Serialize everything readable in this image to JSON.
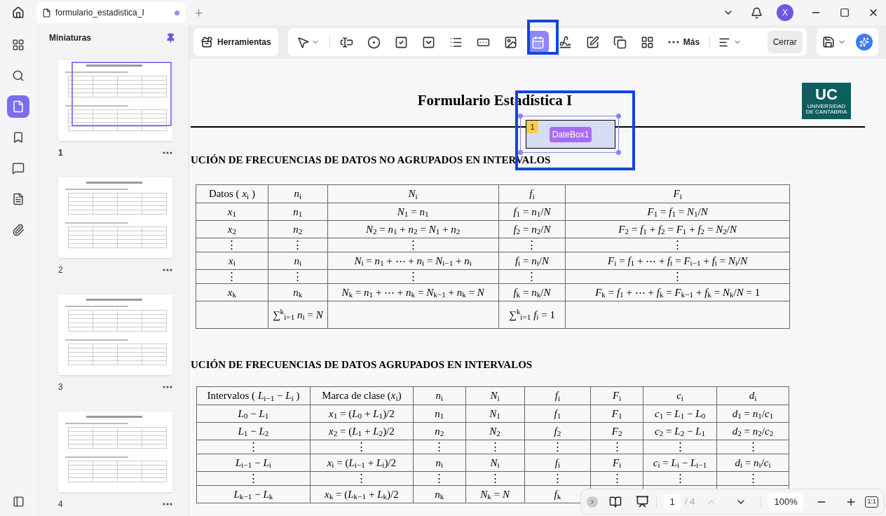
{
  "title_bar": {
    "tab": {
      "title": "formulario_estadistica_I",
      "modified": true
    },
    "avatar": "X"
  },
  "rail": [
    {
      "selected": false
    },
    {
      "selected": false
    },
    {
      "selected": true
    },
    {
      "selected": false
    },
    {
      "selected": false
    },
    {
      "selected": false
    },
    {
      "selected": false
    }
  ],
  "thumbnails": {
    "title": "Miniaturas",
    "pages": [
      {
        "label": "1",
        "selected": true
      },
      {
        "label": "2",
        "selected": false
      },
      {
        "label": "3",
        "selected": false
      },
      {
        "label": "4",
        "selected": false
      }
    ]
  },
  "toolbar": {
    "tools_button": "Herramientas",
    "tools": [
      {
        "selected": false
      },
      {
        "selected": false
      },
      {
        "selected": false
      },
      {
        "selected": false
      },
      {
        "selected": false
      },
      {
        "selected": false
      },
      {
        "selected": false
      },
      {
        "selected": false
      },
      {
        "selected": true
      },
      {
        "selected": false
      },
      {
        "selected": false
      },
      {
        "selected": false
      },
      {
        "selected": false
      }
    ],
    "more": "Más",
    "close": "Cerrar"
  },
  "document": {
    "title": "Formulario Estadística I",
    "logo": {
      "mark": "UC",
      "line1": "UNIVERSIDAD",
      "line2": "DE CANTABRIA"
    },
    "date_field": {
      "number": "1",
      "label": "DateBox1"
    },
    "sections": [
      {
        "heading": "UCIÓN DE FRECUENCIAS DE DATOS NO AGRUPADOS EN INTERVALOS",
        "table": {
          "header": [
            "Datos ( *x*$_{i}$ )",
            "*n*$_{i}$",
            "*N*$_{i}$",
            "*f*$_{i}$",
            "*F*$_{i}$"
          ],
          "rows": [
            {
              "kind": "math",
              "cells": [
                "*x*$_{1}$",
                "*n*$_{1}$",
                "*N*$_{1}$ = *n*$_{1}$",
                "*f*$_{1}$ = *n*$_{1}$/*N*",
                "*F*$_{1}$ = *f*$_{1}$ = *N*$_{1}$/*N*"
              ]
            },
            {
              "kind": "math",
              "cells": [
                "*x*$_{2}$",
                "*n*$_{2}$",
                "*N*$_{2}$ = *n*$_{1}$ + *n*$_{2}$ = *N*$_{1}$ + *n*$_{2}$",
                "*f*$_{2}$ = *n*$_{2}$/*N*",
                "*F*$_{2}$ = *f*$_{1}$ + *f*$_{2}$ = *F*$_{1}$ + *f*$_{2}$ = *N*$_{2}$/*N*"
              ]
            },
            {
              "kind": "dots",
              "cells": [
                "⋮",
                "⋮",
                "⋮",
                "⋮",
                "⋮"
              ]
            },
            {
              "kind": "math",
              "cells": [
                "*x*$_{i}$",
                "*n*$_{i}$",
                "*N*$_{i}$ = *n*$_{1}$ + ⋯ + *n*$_{i}$ = *N*$_{i−1}$ + *n*$_{i}$",
                "*f*$_{i}$ = *n*$_{i}$/*N*",
                "*F*$_{i}$ = *f*$_{1}$ + ⋯ + *f*$_{i}$ = *F*$_{i−1}$ + *f*$_{i}$ = *N*$_{i}$/*N*"
              ]
            },
            {
              "kind": "dots",
              "cells": [
                "⋮",
                "⋮",
                "⋮",
                "⋮",
                "⋮"
              ]
            },
            {
              "kind": "math",
              "cells": [
                "*x*$_{k}$",
                "*n*$_{k}$",
                "*N*$_{k}$ = *n*$_{1}$ + ⋯ + *n*$_{k}$ = *N*$_{k−1}$ + *n*$_{k}$ = *N*",
                "*f*$_{k}$ = *n*$_{k}$/*N*",
                "*F*$_{k}$ = *f*$_{1}$ + ⋯ + *f*$_{k}$ = *F*$_{k−1}$ + *f*$_{k}$ = *N*$_{k}$/*N* = 1"
              ]
            },
            {
              "kind": "sum",
              "cells": [
                null,
                "∑$^{k}$$_{i=1}$ *n*$_{i}$ = *N*",
                null,
                "∑$^{k}$$_{i=1}$ *f*$_{i}$ = 1",
                null
              ]
            }
          ]
        }
      },
      {
        "heading": "UCIÓN DE FRECUENCIAS DE DATOS AGRUPADOS EN INTERVALOS",
        "table": {
          "header": [
            "Intervalos ( *L*$_{i−1}$ − *L*$_{i}$ )",
            "Marca de clase (*x*$_{i}$)",
            "*n*$_{i}$",
            "*N*$_{i}$",
            "*f*$_{i}$",
            "*F*$_{i}$",
            "*c*$_{i}$",
            "*d*$_{i}$"
          ],
          "rows": [
            {
              "kind": "math",
              "cells": [
                "*L*$_{0}$ − *L*$_{1}$",
                "*x*$_{1}$ = (*L*$_{0}$ + *L*$_{1}$)/2",
                "*n*$_{1}$",
                "*N*$_{1}$",
                "*f*$_{1}$",
                "*F*$_{1}$",
                "*c*$_{1}$ = *L*$_{1}$ − *L*$_{0}$",
                "*d*$_{1}$ = *n*$_{1}$/*c*$_{1}$"
              ]
            },
            {
              "kind": "math",
              "cells": [
                "*L*$_{1}$ − *L*$_{2}$",
                "*x*$_{2}$ = (*L*$_{1}$ + *L*$_{2}$)/2",
                "*n*$_{2}$",
                "*N*$_{2}$",
                "*f*$_{2}$",
                "*F*$_{2}$",
                "*c*$_{2}$ = *L*$_{2}$ − *L*$_{1}$",
                "*d*$_{2}$ = *n*$_{2}$/*c*$_{2}$"
              ]
            },
            {
              "kind": "dots",
              "cells": [
                "⋮",
                "⋮",
                "⋮",
                "⋮",
                "⋮",
                "⋮",
                "⋮",
                "⋮"
              ]
            },
            {
              "kind": "math",
              "cells": [
                "*L*$_{i−1}$ − *L*$_{i}$",
                "*x*$_{i}$ = (*L*$_{i−1}$ + *L*$_{i}$)/2",
                "*n*$_{i}$",
                "*N*$_{i}$",
                "*f*$_{i}$",
                "*F*$_{i}$",
                "*c*$_{i}$ = *L*$_{i}$ − *L*$_{i−1}$",
                "*d*$_{i}$ = *n*$_{i}$/*c*$_{i}$"
              ]
            },
            {
              "kind": "dots",
              "cells": [
                "⋮",
                "⋮",
                "⋮",
                "⋮",
                "⋮",
                "⋮",
                "⋮",
                "⋮"
              ]
            },
            {
              "kind": "math",
              "cells": [
                "*L*$_{k−1}$ − *L*$_{k}$",
                "*x*$_{k}$ = (*L*$_{k−1}$ + *L*$_{k}$)/2",
                "*n*$_{k}$",
                "*N*$_{k}$ = *N*",
                "*f*$_{k}$",
                null,
                null,
                null
              ]
            }
          ]
        }
      }
    ]
  },
  "page_nav": {
    "page": "1",
    "total": "/ 4",
    "prev_disabled": true,
    "zoom": "100%",
    "actual_size": "1:1"
  }
}
